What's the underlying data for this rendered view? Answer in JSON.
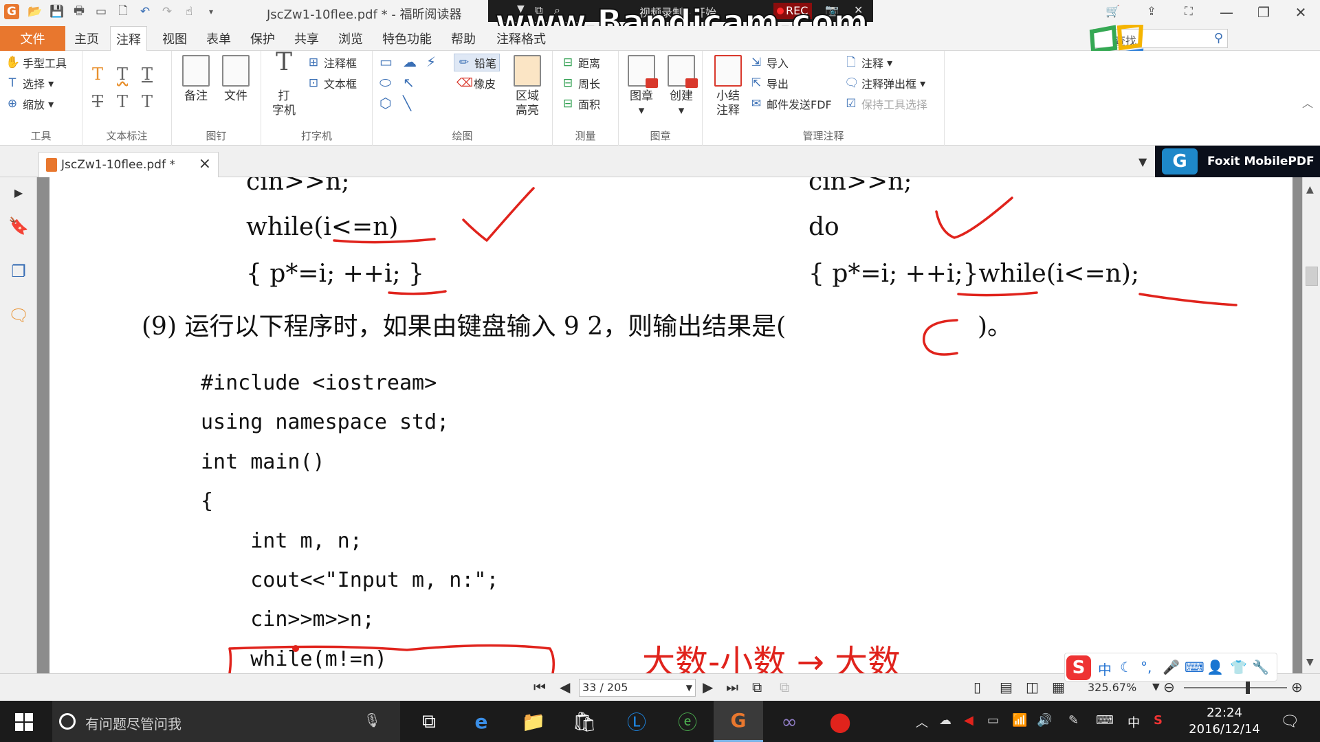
{
  "window": {
    "title": "JscZw1-10flee.pdf * - 福昕阅读器",
    "minimize_glyph": "—",
    "restore_glyph": "❐",
    "close_glyph": "✕"
  },
  "recorder": {
    "watermark": "www.Bandicam.com",
    "status": "视频录制 - 开始",
    "rec_label": "REC"
  },
  "menu": {
    "file": "文件",
    "tabs": [
      "主页",
      "注释",
      "视图",
      "表单",
      "保护",
      "共享",
      "浏览",
      "特色功能",
      "帮助",
      "注释格式"
    ],
    "active_tab": "注释",
    "search_label": "查找"
  },
  "ribbon": {
    "tools": {
      "label": "工具",
      "hand": "手型工具",
      "select": "选择",
      "zoom": "缩放"
    },
    "text_markup": {
      "label": "文本标注"
    },
    "pin": {
      "label": "图钉",
      "note": "备注",
      "file": "文件"
    },
    "typewriter": {
      "label": "打字机",
      "typewriter_a": "打",
      "typewriter_b": "字机",
      "callout": "注释框",
      "textbox": "文本框"
    },
    "drawing": {
      "label": "绘图",
      "pencil": "铅笔",
      "eraser": "橡皮",
      "area_a": "区域",
      "area_b": "高亮"
    },
    "measure": {
      "label": "测量",
      "distance": "距离",
      "perimeter": "周长",
      "area": "面积"
    },
    "stamp": {
      "label": "图章",
      "stamp": "图章",
      "create": "创建"
    },
    "manage": {
      "label": "管理注释",
      "summary_a": "小结",
      "summary_b": "注释",
      "import": "导入",
      "export": "导出",
      "email": "邮件发送FDF",
      "annot": "注释",
      "popup": "注释弹出框",
      "keep_tool": "保持工具选择"
    }
  },
  "document": {
    "tab_name": "JscZw1-10flee.pdf *",
    "banner": "Foxit MobilePDF",
    "content": {
      "left_cin": "cin>>n;",
      "left_while": "while(i<=n)",
      "left_body": "{ p*=i; ++i; }",
      "right_cin": "cin>>n;",
      "right_do": "do",
      "right_body": "{ p*=i; ++i;}while(i<=n);",
      "question": "(9) 运行以下程序时，如果由键盘输入 9 2，则输出结果是(",
      "question_end": ")。",
      "answer_mark": "C",
      "code": [
        "#include <iostream>",
        "using namespace std;",
        "int main()",
        "{",
        "    int m, n;",
        "    cout<<\"Input m, n:\";",
        "    cin>>m>>n;",
        "    while(m!=n)"
      ],
      "handwriting": "大数-小数 → 大数"
    }
  },
  "status": {
    "page_box": "33 / 205",
    "zoom": "325.67%"
  },
  "taskbar": {
    "search_placeholder": "有问题尽管问我",
    "time": "22:24",
    "date": "2016/12/14",
    "ime_indicator": "中"
  },
  "ime_bar": {
    "mode": "中"
  },
  "colors": {
    "foxit_orange": "#e8772e",
    "annotation_red": "#e0231c",
    "taskbar": "#1b1b1b"
  }
}
